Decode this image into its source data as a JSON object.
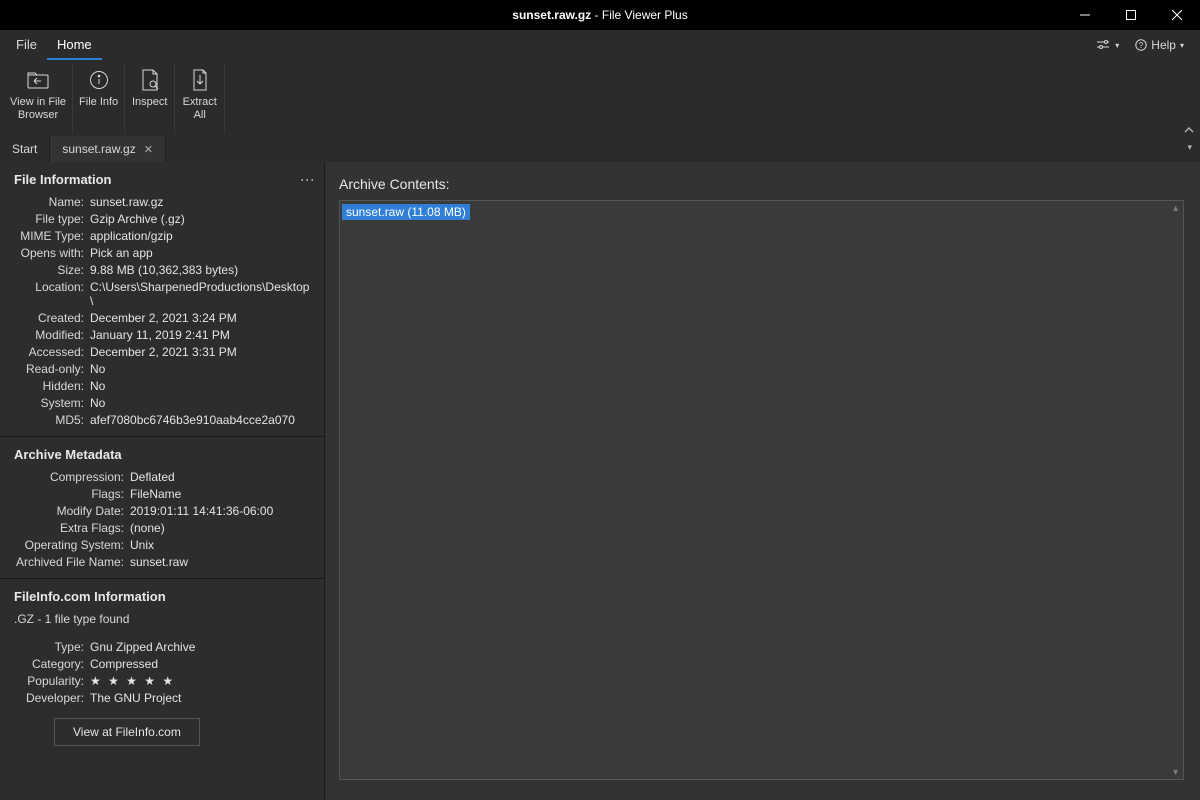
{
  "titlebar": {
    "filename": "sunset.raw.gz",
    "appname": "File Viewer Plus"
  },
  "menubar": {
    "file": "File",
    "home": "Home",
    "help": "Help"
  },
  "ribbon": {
    "view_in_browser": "View in File\nBrowser",
    "file_info": "File Info",
    "inspect": "Inspect",
    "extract_all": "Extract\nAll"
  },
  "tabs": {
    "start": "Start",
    "file": "sunset.raw.gz"
  },
  "file_info": {
    "title": "File Information",
    "rows": {
      "name": {
        "label": "Name:",
        "value": "sunset.raw.gz"
      },
      "filetype": {
        "label": "File type:",
        "value": "Gzip Archive (.gz)"
      },
      "mime": {
        "label": "MIME Type:",
        "value": "application/gzip"
      },
      "opens_with": {
        "label": "Opens with:",
        "value": "Pick an app"
      },
      "size": {
        "label": "Size:",
        "value": "9.88 MB (10,362,383 bytes)"
      },
      "location": {
        "label": "Location:",
        "value": "C:\\Users\\SharpenedProductions\\Desktop\\"
      },
      "created": {
        "label": "Created:",
        "value": "December 2, 2021 3:24 PM"
      },
      "modified": {
        "label": "Modified:",
        "value": "January 11, 2019 2:41 PM"
      },
      "accessed": {
        "label": "Accessed:",
        "value": "December 2, 2021 3:31 PM"
      },
      "readonly": {
        "label": "Read-only:",
        "value": "No"
      },
      "hidden": {
        "label": "Hidden:",
        "value": "No"
      },
      "system": {
        "label": "System:",
        "value": "No"
      },
      "md5": {
        "label": "MD5:",
        "value": "afef7080bc6746b3e910aab4cce2a070"
      }
    }
  },
  "archive_meta": {
    "title": "Archive Metadata",
    "rows": {
      "compression": {
        "label": "Compression:",
        "value": "Deflated"
      },
      "flags": {
        "label": "Flags:",
        "value": "FileName"
      },
      "modify_date": {
        "label": "Modify Date:",
        "value": "2019:01:11 14:41:36-06:00"
      },
      "extra_flags": {
        "label": "Extra Flags:",
        "value": "(none)"
      },
      "os": {
        "label": "Operating System:",
        "value": "Unix"
      },
      "archived_name": {
        "label": "Archived File Name:",
        "value": "sunset.raw"
      }
    }
  },
  "fileinfo_com": {
    "title": "FileInfo.com Information",
    "subtitle": ".GZ - 1 file type found",
    "rows": {
      "type": {
        "label": "Type:",
        "value": "Gnu Zipped Archive"
      },
      "category": {
        "label": "Category:",
        "value": "Compressed"
      },
      "popularity": {
        "label": "Popularity:",
        "value": "★ ★ ★ ★ ★"
      },
      "developer": {
        "label": "Developer:",
        "value": "The GNU Project"
      }
    },
    "view_btn": "View at FileInfo.com"
  },
  "archive": {
    "title": "Archive Contents:",
    "item": "sunset.raw (11.08 MB)"
  }
}
